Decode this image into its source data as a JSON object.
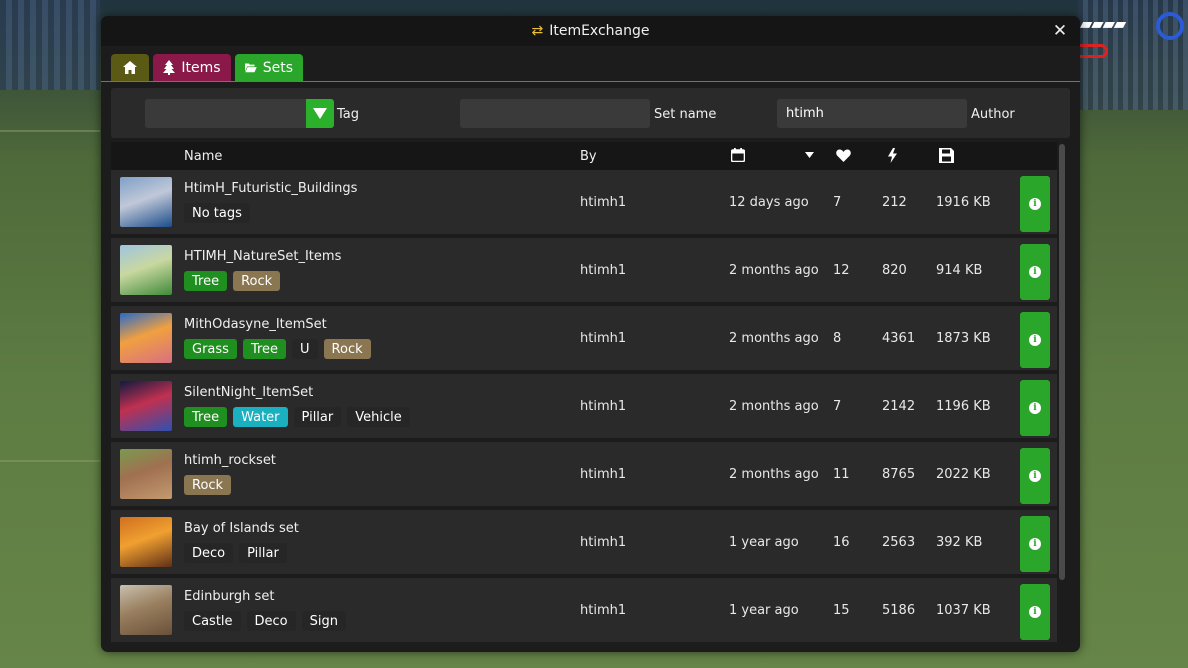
{
  "window": {
    "title": "ItemExchange"
  },
  "tabs": [
    {
      "label": "",
      "icon": "home-icon"
    },
    {
      "label": "Items",
      "icon": "tree-icon"
    },
    {
      "label": "Sets",
      "icon": "folder-open-icon"
    }
  ],
  "filters": {
    "tag_label": "Tag",
    "tag_value": "",
    "setname_label": "Set name",
    "setname_value": "",
    "author_label": "Author",
    "author_value": "htimh"
  },
  "columns": {
    "name": "Name",
    "by": "By",
    "date_icon": "calendar-icon",
    "sort_icon": "sort-down-icon",
    "likes_icon": "heart-icon",
    "downloads_icon": "bolt-icon",
    "size_icon": "floppy-disk-icon"
  },
  "rows": [
    {
      "name": "HtimH_Futuristic_Buildings",
      "tags": [
        {
          "label": "No tags",
          "kind": "plain"
        }
      ],
      "by": "htimh1",
      "date": "12 days ago",
      "likes": "7",
      "downloads": "212",
      "size": "1916 KB",
      "thumb_colors": [
        "#7fa0c8",
        "#1c4d8a",
        "#c0c8d8"
      ]
    },
    {
      "name": "HTIMH_NatureSet_Items",
      "tags": [
        {
          "label": "Tree",
          "kind": "tree"
        },
        {
          "label": "Rock",
          "kind": "rock"
        }
      ],
      "by": "htimh1",
      "date": "2 months ago",
      "likes": "12",
      "downloads": "820",
      "size": "914 KB",
      "thumb_colors": [
        "#9fc4e0",
        "#3f8a3a",
        "#c9d8a0"
      ]
    },
    {
      "name": "MithOdasyne_ItemSet",
      "tags": [
        {
          "label": "Grass",
          "kind": "grass"
        },
        {
          "label": "Tree",
          "kind": "tree"
        },
        {
          "label": "U",
          "kind": "plain"
        },
        {
          "label": "Rock",
          "kind": "rock"
        }
      ],
      "by": "htimh1",
      "date": "2 months ago",
      "likes": "8",
      "downloads": "4361",
      "size": "1873 KB",
      "thumb_colors": [
        "#2a6ac8",
        "#d87080",
        "#f0a040"
      ]
    },
    {
      "name": "SilentNight_ItemSet",
      "tags": [
        {
          "label": "Tree",
          "kind": "tree"
        },
        {
          "label": "Water",
          "kind": "water"
        },
        {
          "label": "Pillar",
          "kind": "plain"
        },
        {
          "label": "Vehicle",
          "kind": "plain"
        }
      ],
      "by": "htimh1",
      "date": "2 months ago",
      "likes": "7",
      "downloads": "2142",
      "size": "1196 KB",
      "thumb_colors": [
        "#101a40",
        "#3050b0",
        "#c03050"
      ]
    },
    {
      "name": "htimh_rockset",
      "tags": [
        {
          "label": "Rock",
          "kind": "rock"
        }
      ],
      "by": "htimh1",
      "date": "2 months ago",
      "likes": "11",
      "downloads": "8765",
      "size": "2022 KB",
      "thumb_colors": [
        "#7a9a50",
        "#c49a70",
        "#a07050"
      ]
    },
    {
      "name": "Bay of Islands set",
      "tags": [
        {
          "label": "Deco",
          "kind": "plain"
        },
        {
          "label": "Pillar",
          "kind": "plain"
        }
      ],
      "by": "htimh1",
      "date": "1 year ago",
      "likes": "16",
      "downloads": "2563",
      "size": "392 KB",
      "thumb_colors": [
        "#d07020",
        "#603018",
        "#f0a030"
      ]
    },
    {
      "name": "Edinburgh set",
      "tags": [
        {
          "label": "Castle",
          "kind": "plain"
        },
        {
          "label": "Deco",
          "kind": "plain"
        },
        {
          "label": "Sign",
          "kind": "plain"
        }
      ],
      "by": "htimh1",
      "date": "1 year ago",
      "likes": "15",
      "downloads": "5186",
      "size": "1037 KB",
      "thumb_colors": [
        "#c8c0b0",
        "#6a5038",
        "#9a8060"
      ]
    }
  ],
  "colors": {
    "accent": "#2aa62a",
    "items_tab": "#8a1848",
    "home_tab": "#5a5a14",
    "tag_rock": "#8a7650",
    "tag_water": "#1ab0c0"
  }
}
